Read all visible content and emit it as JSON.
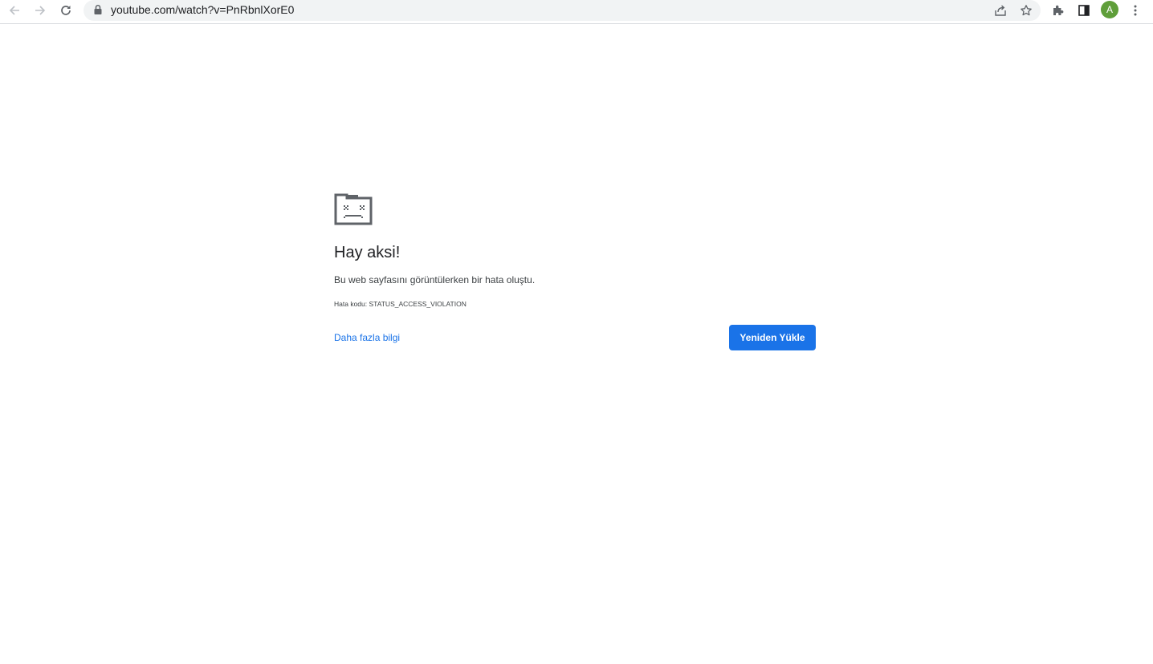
{
  "browser": {
    "url": "youtube.com/watch?v=PnRbnlXorE0",
    "profile_initial": "A",
    "profile_color": "#5f9e3a",
    "icons": {
      "back": "back-arrow-icon",
      "forward": "forward-arrow-icon",
      "reload": "reload-icon",
      "lock": "lock-icon",
      "share": "share-icon",
      "bookmark": "star-icon",
      "extensions": "puzzle-icon",
      "side_panel": "side-panel-icon",
      "menu": "kebab-menu-icon"
    }
  },
  "error_page": {
    "icon": "sad-folder-icon",
    "heading": "Hay aksi!",
    "message": "Bu web sayfasını görüntülerken bir hata oluştu.",
    "error_code": "Hata kodu: STATUS_ACCESS_VIOLATION",
    "learn_more_label": "Daha fazla bilgi",
    "reload_label": "Yeniden Yükle",
    "accent_color": "#1a73e8"
  }
}
